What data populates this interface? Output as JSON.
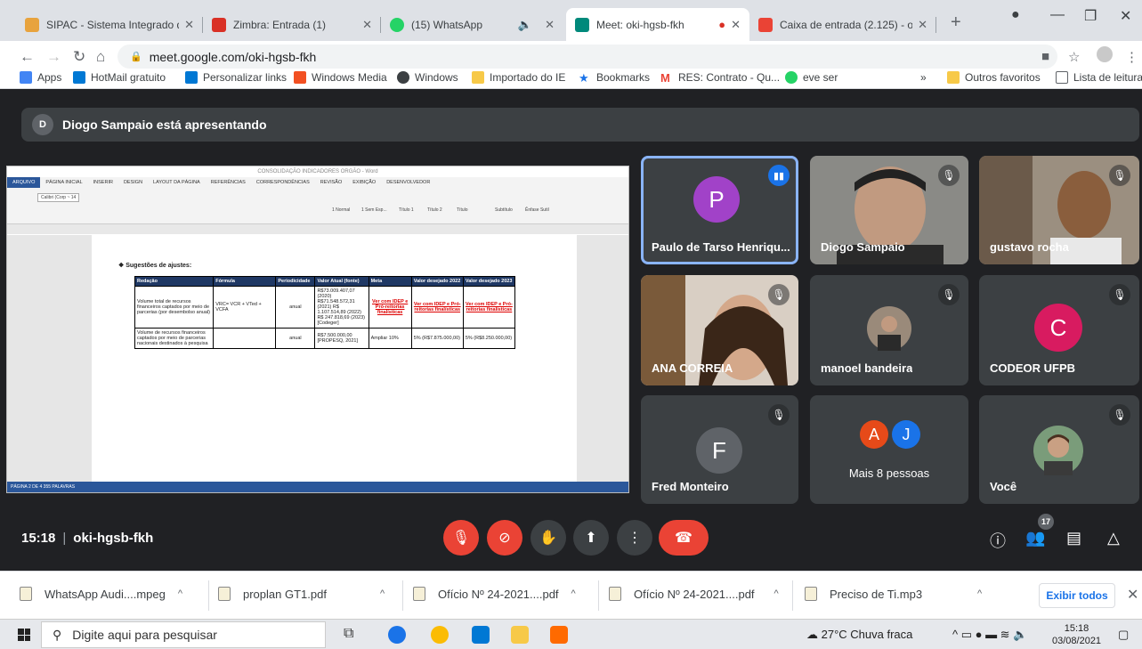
{
  "browser": {
    "tabs": [
      {
        "title": "SIPAC - Sistema Integrado de",
        "color": "#e8a33d"
      },
      {
        "title": "Zimbra: Entrada (1)",
        "color": "#d93025"
      },
      {
        "title": "(15) WhatsApp",
        "color": "#25d366"
      },
      {
        "title": "Meet: oki-hgsb-fkh",
        "color": "#00897b"
      },
      {
        "title": "Caixa de entrada (2.125) - os",
        "color": "#ea4335"
      }
    ],
    "url": "meet.google.com/oki-hgsb-fkh",
    "bookmarks": [
      "Apps",
      "HotMail gratuito",
      "Personalizar links",
      "Windows Media",
      "Windows",
      "Importado do IE",
      "Bookmarks",
      "RES: Contrato - Qu...",
      "eve ser"
    ],
    "bookmarks_right": [
      "»",
      "Outros favoritos",
      "Lista de leitura"
    ]
  },
  "meet": {
    "presenter": {
      "initial": "D",
      "text": "Diogo Sampaio está apresentando"
    },
    "doc": {
      "window_title": "CONSOLIDAÇÃO INDICADORES ORGÃO - Word",
      "ribbon_tabs": [
        "ARQUIVO",
        "PÁGINA INICIAL",
        "INSERIR",
        "DESIGN",
        "LAYOUT DA PÁGINA",
        "REFERÊNCIAS",
        "CORRESPONDÊNCIAS",
        "REVISÃO",
        "EXIBIÇÃO",
        "DESENVOLVEDOR"
      ],
      "font": "Calibri (Corp ~ 14",
      "styles": [
        "1 Normal",
        "1 Sem Esp...",
        "Título 1",
        "Título 2",
        "Título",
        "Subtítulo",
        "Ênfase Sutil"
      ],
      "status": "PÁGINA 2 DE 4    355 PALAVRAS",
      "heading": "Sugestões de ajustes:",
      "headers": [
        "Redação",
        "Fórmula",
        "Periodicidade",
        "Valor Atual (fonte)",
        "Meta",
        "Valor desejado 2022",
        "Valor desejado 2023"
      ],
      "rows": [
        [
          "Volume total de recursos financeiros captados por meio de parcerias (por desembolso anual)",
          "VRC= VCR + VTed + VCFA",
          "anual",
          "R$73.009.407,07 (2020) R$71.548.572,31 (2021) R$ 1.107.514,89 (2022) R$ 247.818,69 (2023) [Codeger]",
          "Ver com IDEP e Pró-reitorias finalísticas",
          "Ver com IDEP e Pró-reitorias finalísticas",
          "Ver com IDEP e Pró-reitorias finalísticas"
        ],
        [
          "Volume de recursos financeiros captados por meio de parcerias nacionais destinados à pesquisa",
          "",
          "anual",
          "R$7.500.000,00 [PROPESQ, 2021]",
          "Ampliar 10%",
          "5% (R$7.875.000,00)",
          "5% (R$8.250.000,00)"
        ]
      ]
    },
    "participants": [
      {
        "name": "Paulo de Tarso Henriqu...",
        "initial": "P",
        "color": "#a142c8"
      },
      {
        "name": "Diogo Sampaio"
      },
      {
        "name": "gustavo rocha"
      },
      {
        "name": "ANA CORREIA"
      },
      {
        "name": "manoel bandeira"
      },
      {
        "name": "CODEOR UFPB",
        "initial": "C",
        "color": "#d81b60"
      },
      {
        "name": "Fred Monteiro",
        "initial": "F",
        "color": "#5f6368"
      },
      {
        "name": "Mais 8 pessoas",
        "initials": [
          "A",
          "J"
        ],
        "colors": [
          "#e64a19",
          "#1a73e8"
        ]
      },
      {
        "name": "Você"
      }
    ],
    "time": "15:18",
    "meeting_code": "oki-hgsb-fkh",
    "people_count": "17"
  },
  "downloads": [
    "WhatsApp Audi....mpeg",
    "proplan GT1.pdf",
    "Ofício Nº 24-2021....pdf",
    "Ofício Nº 24-2021....pdf",
    "Preciso de Ti.mp3"
  ],
  "show_all": "Exibir todos",
  "taskbar": {
    "search_placeholder": "Digite aqui para pesquisar",
    "weather": "27°C  Chuva fraca",
    "time": "15:18",
    "date": "03/08/2021"
  }
}
